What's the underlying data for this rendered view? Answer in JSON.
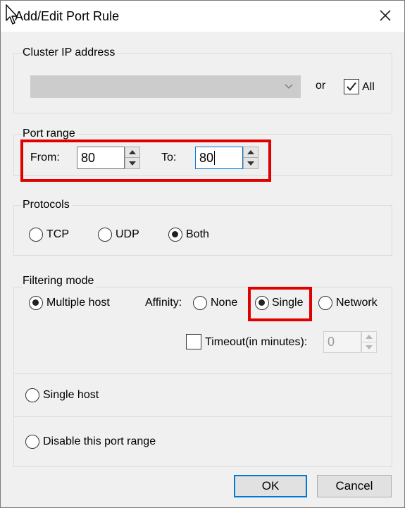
{
  "window": {
    "title": "Add/Edit Port Rule"
  },
  "cluster_ip": {
    "legend": "Cluster IP address",
    "address_value": "",
    "or_label": "or",
    "all_label": "All",
    "all_checked": true
  },
  "port_range": {
    "legend": "Port range",
    "from_label": "From:",
    "from_value": "80",
    "to_label": "To:",
    "to_value": "80"
  },
  "protocols": {
    "legend": "Protocols",
    "tcp_label": "TCP",
    "udp_label": "UDP",
    "both_label": "Both",
    "selected": "Both"
  },
  "filtering": {
    "legend": "Filtering mode",
    "multiple_host_label": "Multiple host",
    "affinity_label": "Affinity:",
    "none_label": "None",
    "single_label": "Single",
    "network_label": "Network",
    "affinity_selected": "Single",
    "timeout_label": "Timeout(in minutes):",
    "timeout_checked": false,
    "timeout_value": "0",
    "single_host_label": "Single host",
    "disable_label": "Disable this port range",
    "mode_selected": "Multiple host"
  },
  "buttons": {
    "ok_label": "OK",
    "cancel_label": "Cancel"
  },
  "colors": {
    "highlight": "#e00000",
    "focus_accent": "#0078d7",
    "dialog_background": "#f0f0f0"
  },
  "icons": {
    "cursor": "mouse-pointer-icon",
    "close": "close-icon",
    "dropdown": "chevron-down-icon",
    "check": "checkmark-icon",
    "spin_up": "triangle-up-icon",
    "spin_down": "triangle-down-icon"
  }
}
